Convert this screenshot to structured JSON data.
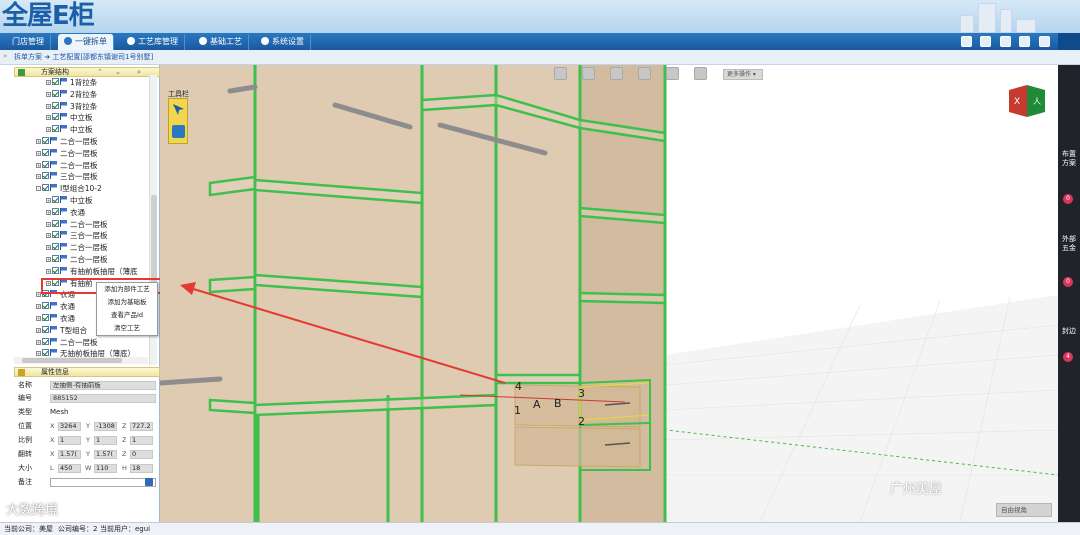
{
  "app": {
    "logo": "全屋E柜"
  },
  "nav": {
    "tabs": [
      {
        "label": "门店管理"
      },
      {
        "label": "一键拆单"
      },
      {
        "label": "工艺库管理"
      },
      {
        "label": "基础工艺"
      },
      {
        "label": "系统设置"
      }
    ],
    "icons": [
      "monitor-icon",
      "folder-icon",
      "user-icon",
      "gear-icon",
      "exit-icon"
    ]
  },
  "breadcrumb": {
    "prefix": "»",
    "text": "拆单方案 ➜ 工艺配置[邵都东镇谢司1号别墅]"
  },
  "tree": {
    "header": "方案结构",
    "items": [
      {
        "label": "1背拉条",
        "indent": 3,
        "expand": "+"
      },
      {
        "label": "2背拉条",
        "indent": 3,
        "expand": "+"
      },
      {
        "label": "3背拉条",
        "indent": 3,
        "expand": "+"
      },
      {
        "label": "中立板",
        "indent": 3,
        "expand": "+"
      },
      {
        "label": "中立板",
        "indent": 3,
        "expand": "+"
      },
      {
        "label": "二合一层板",
        "indent": 2,
        "expand": "+"
      },
      {
        "label": "二合一层板",
        "indent": 2,
        "expand": "+"
      },
      {
        "label": "二合一层板",
        "indent": 2,
        "expand": "+"
      },
      {
        "label": "三合一层板",
        "indent": 2,
        "expand": "+"
      },
      {
        "label": "I型组合10-2",
        "indent": 2,
        "expand": "-"
      },
      {
        "label": "中立板",
        "indent": 3,
        "expand": "+"
      },
      {
        "label": "衣通",
        "indent": 3,
        "expand": "+"
      },
      {
        "label": "二合一层板",
        "indent": 3,
        "expand": "+"
      },
      {
        "label": "三合一层板",
        "indent": 3,
        "expand": "+"
      },
      {
        "label": "二合一层板",
        "indent": 3,
        "expand": "+"
      },
      {
        "label": "二合一层板",
        "indent": 3,
        "expand": "+"
      },
      {
        "label": "有抽前板抽屉（薄底",
        "indent": 3,
        "expand": "+"
      },
      {
        "label": "有抽前",
        "indent": 3,
        "expand": "+"
      },
      {
        "label": "衣通",
        "indent": 2,
        "expand": "+"
      },
      {
        "label": "衣通",
        "indent": 2,
        "expand": "+"
      },
      {
        "label": "衣通",
        "indent": 2,
        "expand": "+"
      },
      {
        "label": "T型组合",
        "indent": 2,
        "expand": "+"
      },
      {
        "label": "二合一层板",
        "indent": 2,
        "expand": "+"
      },
      {
        "label": "无抽前板抽屉（薄底）",
        "indent": 2,
        "expand": "+"
      }
    ]
  },
  "context_menu": {
    "items": [
      "添加为部件工艺",
      "添加为基础板",
      "查看产品Id",
      "清空工艺"
    ]
  },
  "properties": {
    "header": "属性信息",
    "name": {
      "label": "名称",
      "value": "左抽侧-有抽前板"
    },
    "code": {
      "label": "编号",
      "value": "885152"
    },
    "type": {
      "label": "类型",
      "value": "Mesh"
    },
    "position": {
      "label": "位置",
      "x": "3264",
      "y": "-1308",
      "z": "727.2"
    },
    "scale": {
      "label": "比例",
      "x": "1",
      "y": "1",
      "z": "1"
    },
    "rotation": {
      "label": "翻转",
      "x": "1.57(",
      "y": "1.57(",
      "z": "0"
    },
    "size": {
      "label": "大小",
      "l": "450",
      "w": "110",
      "h": "18"
    },
    "note": {
      "label": "备注",
      "value": ""
    },
    "axis_labels": {
      "x": "X",
      "y": "Y",
      "z": "Z",
      "l": "L",
      "w": "W",
      "h": "H"
    }
  },
  "viewport": {
    "toolbox_title": "工具栏",
    "more_ops": "更多操作 ▾",
    "free_view": "自由视角",
    "markers": [
      "4",
      "A",
      "B",
      "3",
      "1",
      "2"
    ]
  },
  "right_panel": [
    {
      "label": "布置方案",
      "count": "0"
    },
    {
      "label": "外部五金",
      "count": "0"
    },
    {
      "label": "封边",
      "count": "4"
    }
  ],
  "status": {
    "company": "当前公司：美屋",
    "company_id": "公司编号：2",
    "user": "当前用户：egui"
  },
  "overlays": {
    "wechat": "广州美屋",
    "watermark": "大数跨境"
  },
  "colors": {
    "accent": "#1a5fa8",
    "board_green": "#3fbf4c",
    "arrow_red": "#e53a33"
  }
}
